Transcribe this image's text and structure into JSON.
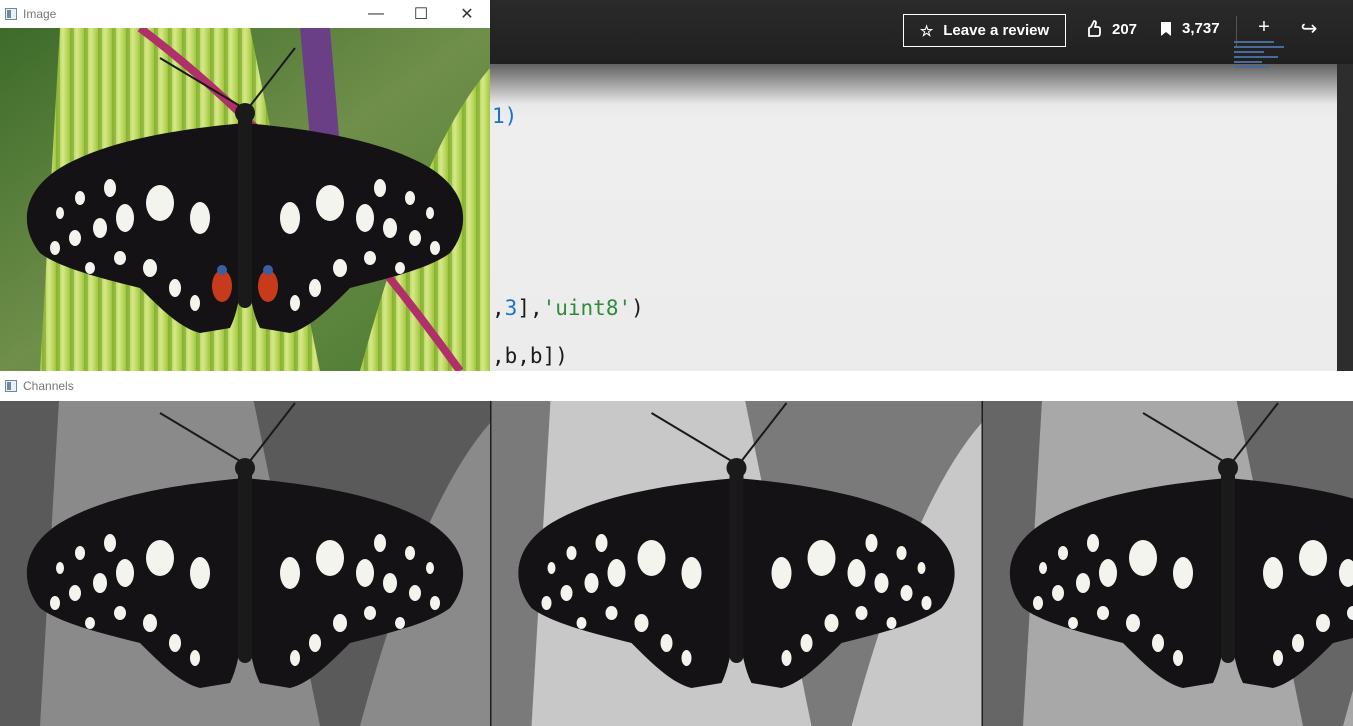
{
  "image_window": {
    "title": "Image",
    "controls": {
      "minimize": "—",
      "maximize": "☐",
      "close": "✕"
    }
  },
  "channels_window": {
    "title": "Channels",
    "panels": [
      "blue-channel",
      "green-channel",
      "red-channel"
    ]
  },
  "player": {
    "review_label": "Leave a review",
    "likes": "207",
    "bookmarks": "3,737",
    "add_icon": "plus-icon",
    "share_icon": "share-icon"
  },
  "code": {
    "line1": "1)",
    "line2_num": "3",
    "line2_rest": "],",
    "line2_str": "'uint8'",
    "line2_end": ")",
    "line2_prefix": ",",
    "line3": ",b,b])"
  },
  "colors": {
    "leaf_green": "#9cc63a",
    "leaf_light": "#d8e88a",
    "stem_magenta": "#b0306a",
    "wing_black": "#141214",
    "spot_white": "#f4f4ef",
    "eyespot_red": "#c83a1c",
    "eyespot_blue": "#3a5fa0"
  }
}
